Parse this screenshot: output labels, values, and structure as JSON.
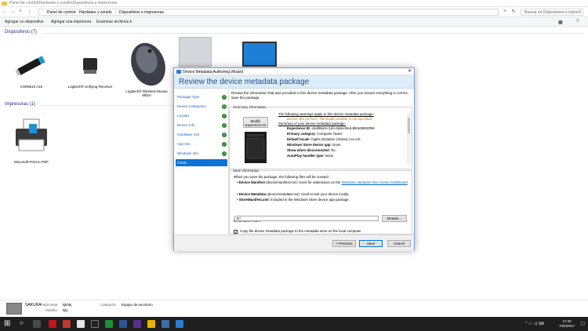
{
  "window": {
    "title": "Panel de control\\Hardware y sonido\\Dispositivos e impresoras"
  },
  "address": {
    "crumbs": [
      "Panel de control",
      "Hardware y sonido",
      "Dispositivos e impresoras"
    ]
  },
  "search": {
    "placeholder": "Buscar en Dispositivos e impre..."
  },
  "commands": [
    "Agregar un dispositivo",
    "Agregar una impresora",
    "Examinar archivos ▾"
  ],
  "groups": {
    "devices": "Dispositivos (7)",
    "printers": "Impresoras (1)"
  },
  "devices": [
    {
      "label": "CSR8510 A10"
    },
    {
      "label": "Logitech® Unifying Receiver"
    },
    {
      "label": "Logitech® Wireless Mouse M510"
    }
  ],
  "printers": [
    {
      "label": "Microsoft Print to PDF"
    }
  ],
  "wizard": {
    "title": "Device Metadata Authoring Wizard",
    "heading": "Review the device metadata package",
    "steps": [
      "Package Type",
      "Device Categories",
      "Locales",
      "Device Info",
      "Hardware Info",
      "App Info",
      "Windows Info",
      "Finish"
    ],
    "intro": "Review the information that was provided in this device metadata package. After you ensure everything is correct, save the package.",
    "summary": {
      "legend": "Summary information",
      "modify_button": "Modify Experience ID",
      "warning_heading": "The following warnings apply to this device metadata package:",
      "warning_text": "Device Info (en-US): The model number is not specified.",
      "summary_heading": "Summary of your device metadata package:",
      "rows": [
        {
          "k": "Experience ID",
          "v": ": e5af96e8-c1eb-4da6-bfed-8b0e99932f58"
        },
        {
          "k": "Primary category",
          "v": ": Computer.Tower"
        },
        {
          "k": "Default locale",
          "v": ": Inglés (Estados Unidos) | en-US"
        },
        {
          "k": "Windows Store device app",
          "v": ": None"
        },
        {
          "k": "Show when disconnected",
          "v": ": No"
        },
        {
          "k": "AutoPlay handler type",
          "v": ": None"
        }
      ]
    },
    "save": {
      "legend": "Save information",
      "intro": "When you save the package, the following files will be created:",
      "files": [
        {
          "name": "Device Manifest",
          "desc": " (devicemanifest-ms): Used for submission on the ",
          "link": "Windows Hardware Dev Center Dashboard",
          "tail": "."
        },
        {
          "name": "Device Metadata",
          "desc": " (devicemetadata-ms): Used to test your device locally.",
          "link": "",
          "tail": ""
        },
        {
          "name": "StoreManifest.xml",
          "desc": ": Included in the Windows Store device app package.",
          "link": "",
          "tail": ""
        }
      ],
      "dest_label": "Destination folder:",
      "dest_value": "D:\\",
      "browse": "Browse...",
      "checkbox_label": "Copy the device metadata package to the metadata store on the local computer"
    },
    "buttons": {
      "previous": "< Previous",
      "save": "Save",
      "cancel": "Cancel"
    }
  },
  "details": {
    "name": "SAKURA",
    "maker_label": "Fabricante:",
    "maker": "kjkhkj",
    "model_label": "Modelo:",
    "model": "kjkj",
    "cat_label": "Categoría:",
    "category": "Equipo de escritorio"
  },
  "clock": {
    "time": "17:33",
    "date": "7/20/2017"
  }
}
